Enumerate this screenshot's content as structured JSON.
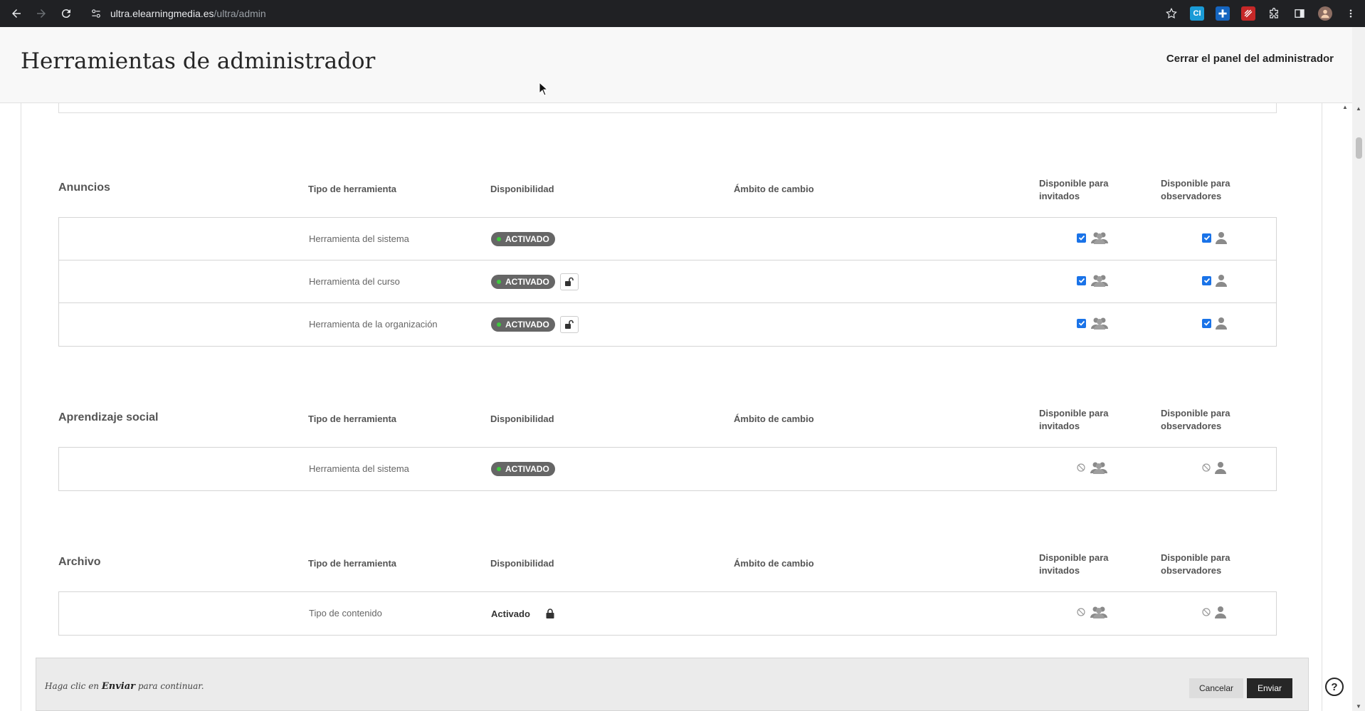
{
  "browser": {
    "url_host": "ultra.elearningmedia.es",
    "url_path": "/ultra/admin"
  },
  "header": {
    "title": "Herramientas de administrador",
    "close_label": "Cerrar el panel del administrador"
  },
  "columns": {
    "type": "Tipo de herramienta",
    "availability": "Disponibilidad",
    "scope": "Ámbito de cambio",
    "guests": "Disponible para invitados",
    "observers": "Disponible para observadores"
  },
  "sections": [
    {
      "title": "Anuncios",
      "rows": [
        {
          "type": "Herramienta del sistema",
          "status": "ACTIVADO"
        },
        {
          "type": "Herramienta del curso",
          "status": "ACTIVADO"
        },
        {
          "type": "Herramienta de la organización",
          "status": "ACTIVADO"
        }
      ]
    },
    {
      "title": "Aprendizaje social",
      "rows": [
        {
          "type": "Herramienta del sistema",
          "status": "ACTIVADO"
        }
      ]
    },
    {
      "title": "Archivo",
      "rows": [
        {
          "type": "Tipo de contenido",
          "status": "Activado"
        }
      ]
    }
  ],
  "footer": {
    "msg_prefix": "Haga clic en",
    "msg_action": "Enviar",
    "msg_suffix": "para continuar.",
    "cancel_label": "Cancelar",
    "submit_label": "Enviar"
  },
  "help_glyph": "?",
  "colors": {
    "badge_bg": "#666666",
    "badge_dot": "#3ec93e",
    "checkbox": "#1a73e8",
    "submit_bg": "#262626"
  }
}
